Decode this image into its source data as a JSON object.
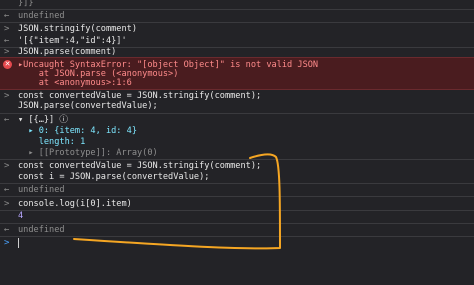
{
  "console": {
    "lines": [
      {
        "gutter": "",
        "text": "}]}",
        "kind": "muted"
      },
      {
        "gutter": "←",
        "text": "undefined",
        "kind": "muted"
      },
      {
        "gutter": ">",
        "text": "JSON.stringify(comment)",
        "kind": "input"
      },
      {
        "gutter": "←",
        "text": "'[{\"item\":4,\"id\":4}]'",
        "kind": "str"
      },
      {
        "gutter": ">",
        "text": "JSON.parse(comment)",
        "kind": "input"
      },
      {
        "gutter": ">",
        "text": "const convertedValue = JSON.stringify(comment);",
        "kind": "input"
      },
      {
        "gutter": "",
        "text": "JSON.parse(convertedValue);",
        "kind": "input"
      },
      {
        "gutter": "←",
        "text": "▾ [{…}] ⓘ",
        "kind": "obj"
      },
      {
        "gutter": "",
        "text": "  ▸ 0: {item: 4, id: 4}",
        "kind": "obj"
      },
      {
        "gutter": "",
        "text": "    length: 1",
        "kind": "obj"
      },
      {
        "gutter": "",
        "text": "  ▸ [[Prototype]]: Array(0)",
        "kind": "obj"
      },
      {
        "gutter": ">",
        "text": "const convertedValue = JSON.stringify(comment);",
        "kind": "input"
      },
      {
        "gutter": "",
        "text": "const i = JSON.parse(convertedValue);",
        "kind": "input"
      },
      {
        "gutter": "←",
        "text": "undefined",
        "kind": "muted"
      },
      {
        "gutter": ">",
        "text": "console.log(i[0].item)",
        "kind": "input"
      },
      {
        "gutter": "",
        "text": "4",
        "kind": "num"
      },
      {
        "gutter": "←",
        "text": "undefined",
        "kind": "muted"
      },
      {
        "gutter": ">",
        "text": "",
        "kind": "prompt"
      }
    ],
    "error": {
      "icon": "error-icon",
      "message": "▸Uncaught SyntaxError: \"[object Object]\" is not valid JSON",
      "stack": [
        "    at JSON.parse (<anonymous>)",
        "    at <anonymous>:1:6"
      ]
    }
  },
  "annotation": {
    "color": "#f5a623"
  }
}
